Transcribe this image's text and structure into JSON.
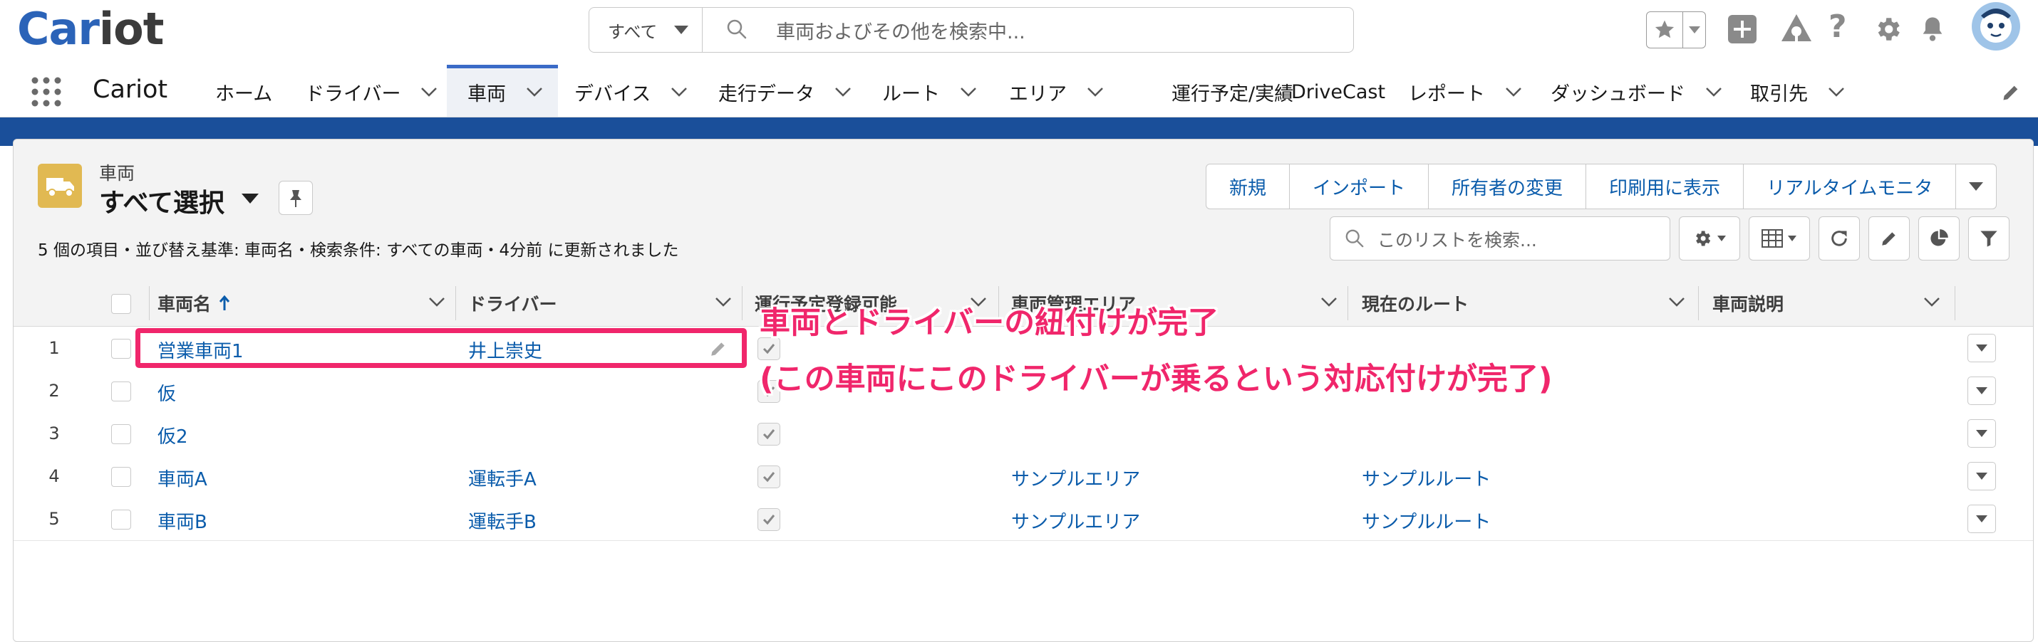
{
  "header": {
    "logo": {
      "first": "Car",
      "rest": "iot"
    },
    "search": {
      "scope": "すべて",
      "placeholder": "車両およびその他を検索中..."
    },
    "icons": [
      "star-icon",
      "add-icon",
      "trailhead-icon",
      "help-icon",
      "setup-gear-icon",
      "bell-icon",
      "avatar-icon"
    ]
  },
  "nav": {
    "app_name": "Cariot",
    "items": [
      "ホーム",
      "ドライバー",
      "車両",
      "デバイス",
      "走行データ",
      "ルート",
      "エリア",
      "運行予定/実績",
      "DriveCast",
      "レポート",
      "ダッシュボード",
      "取引先"
    ],
    "active": "車両"
  },
  "list": {
    "object_label": "車両",
    "title": "すべて選択",
    "info": "5 個の項目・並び替え基準: 車両名・検索条件: すべての車両・4分前 に更新されました",
    "actions": [
      "新規",
      "インポート",
      "所有者の変更",
      "印刷用に表示",
      "リアルタイムモニタ"
    ],
    "search_placeholder": "このリストを検索..."
  },
  "table": {
    "columns": [
      "車両名",
      "ドライバー",
      "運行予定登録可能",
      "車両管理エリア",
      "現在のルート",
      "車両説明"
    ],
    "sort_column": "車両名",
    "rows": [
      {
        "num": "1",
        "name": "営業車両1",
        "driver": "井上崇史",
        "schedulable": true,
        "area": "",
        "route": "",
        "desc": ""
      },
      {
        "num": "2",
        "name": "仮",
        "driver": "",
        "schedulable": true,
        "area": "",
        "route": "",
        "desc": ""
      },
      {
        "num": "3",
        "name": "仮2",
        "driver": "",
        "schedulable": true,
        "area": "",
        "route": "",
        "desc": ""
      },
      {
        "num": "4",
        "name": "車両A",
        "driver": "運転手A",
        "schedulable": true,
        "area": "サンプルエリア",
        "route": "サンプルルート",
        "desc": ""
      },
      {
        "num": "5",
        "name": "車両B",
        "driver": "運転手B",
        "schedulable": true,
        "area": "サンプルエリア",
        "route": "サンプルルート",
        "desc": ""
      }
    ]
  },
  "annotation": {
    "line1": "車両とドライバーの紐付けが完了",
    "line2": "(この車両にこのドライバーが乗るという対応付けが完了)",
    "color": "#f0266b"
  },
  "colors": {
    "link": "#0b5cab",
    "brand_blue": "#1a4f9a",
    "active_tab": "#3a6bc7",
    "object_icon": "#e1b952"
  }
}
